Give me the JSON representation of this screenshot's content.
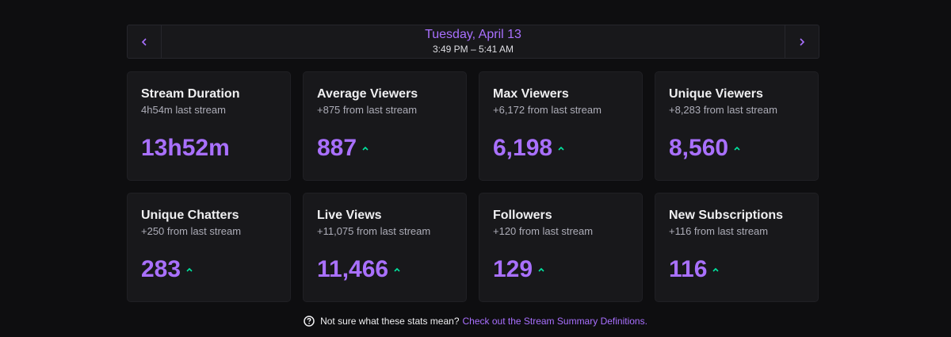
{
  "date_nav": {
    "title": "Tuesday, April 13",
    "time_range": "3:49 PM – 5:41 AM",
    "prev_icon": "chevron-left-icon",
    "next_icon": "chevron-right-icon"
  },
  "colors": {
    "accent": "#a970ff",
    "positive": "#00e5a0",
    "background": "#0e0e10",
    "card": "#18181b"
  },
  "stats": [
    {
      "title": "Stream Duration",
      "sub": "4h54m last stream",
      "value": "13h52m",
      "trend": "none"
    },
    {
      "title": "Average Viewers",
      "sub": "+875 from last stream",
      "value": "887",
      "trend": "up"
    },
    {
      "title": "Max Viewers",
      "sub": "+6,172 from last stream",
      "value": "6,198",
      "trend": "up"
    },
    {
      "title": "Unique Viewers",
      "sub": "+8,283 from last stream",
      "value": "8,560",
      "trend": "up"
    },
    {
      "title": "Unique Chatters",
      "sub": "+250 from last stream",
      "value": "283",
      "trend": "up"
    },
    {
      "title": "Live Views",
      "sub": "+11,075 from last stream",
      "value": "11,466",
      "trend": "up"
    },
    {
      "title": "Followers",
      "sub": "+120 from last stream",
      "value": "129",
      "trend": "up"
    },
    {
      "title": "New Subscriptions",
      "sub": "+116 from last stream",
      "value": "116",
      "trend": "up"
    }
  ],
  "footer": {
    "text": "Not sure what these stats mean?",
    "link": "Check out the Stream Summary Definitions.",
    "icon": "help-circle-icon"
  }
}
